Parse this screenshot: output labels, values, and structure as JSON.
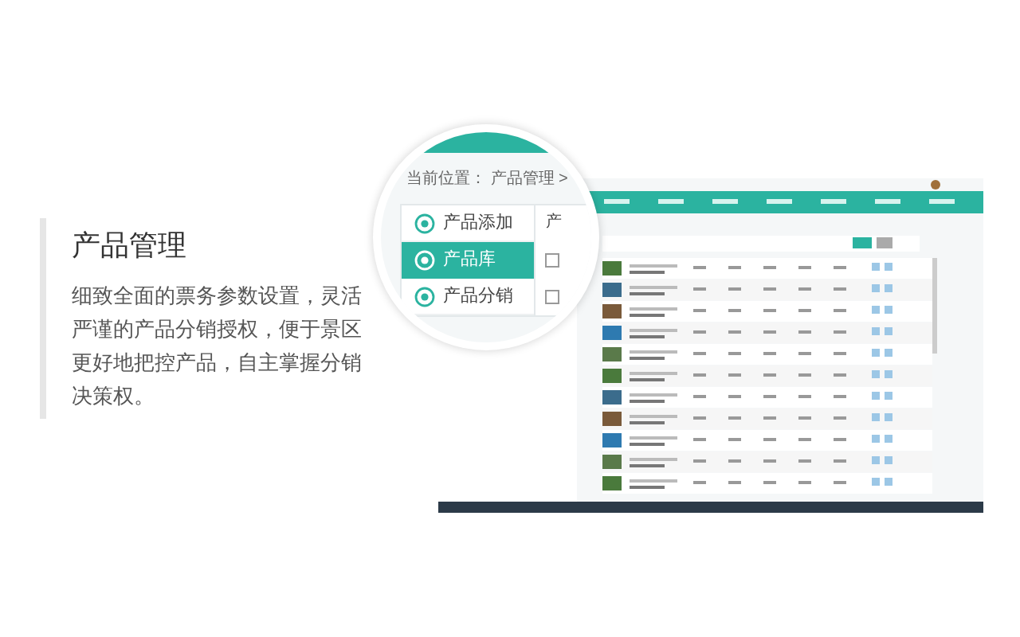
{
  "feature": {
    "title": "产品管理",
    "description": "细致全面的票务参数设置，灵活严谨的产品分销授权，便于景区更好地把控产品，自主掌握分销决策权。"
  },
  "magnifier": {
    "breadcrumb": "当前位置： 产品管理 >",
    "column_header": "产",
    "checkboxes": [
      {
        "checked": false
      },
      {
        "checked": false
      }
    ],
    "menu": [
      {
        "label": "产品添加",
        "selected": false
      },
      {
        "label": "产品库",
        "selected": true
      },
      {
        "label": "产品分销",
        "selected": false
      }
    ]
  }
}
